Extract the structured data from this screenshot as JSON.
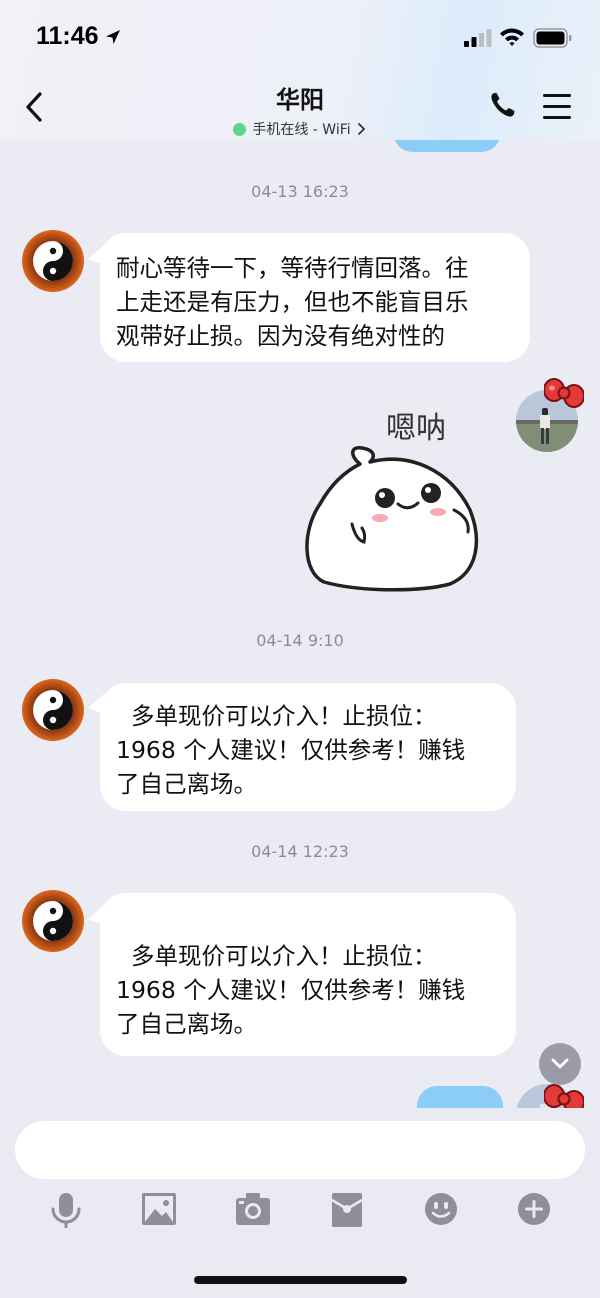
{
  "status_bar": {
    "time": "11:46",
    "icons": [
      "location-arrow-icon",
      "signal-icon",
      "wifi-icon",
      "battery-icon"
    ]
  },
  "header": {
    "back_icon": "chevron-left-icon",
    "title": "华阳",
    "subtitle": "手机在线 - WiFi",
    "online_color": "#5fd58a",
    "actions": [
      "phone-icon",
      "menu-icon"
    ]
  },
  "messages": [
    {
      "timestamp": "04-13 16:23",
      "sender": "other",
      "lines": [
        "耐心等待一下，等待行情回落。往",
        "上走还是有压力，但也不能盲目乐",
        "观带好止损。因为没有绝对性的"
      ]
    },
    {
      "sender": "self",
      "type": "sticker",
      "sticker_text": "嗯呐"
    },
    {
      "timestamp": "04-14 9:10",
      "sender": "other",
      "lines": [
        "  多单现价可以介入！止损位：",
        "1968 个人建议！仅供参考！赚钱",
        "了自己离场。"
      ]
    },
    {
      "timestamp": "04-14 12:23",
      "sender": "other",
      "lines": [
        "",
        "  多单现价可以介入！止损位：",
        "1968 个人建议！仅供参考！赚钱",
        "了自己离场。"
      ]
    }
  ],
  "input": {
    "placeholder": "",
    "value": ""
  },
  "toolbar": [
    "microphone-icon",
    "image-icon",
    "camera-icon",
    "red-envelope-icon",
    "emoji-icon",
    "plus-icon"
  ],
  "colors": {
    "background": "#ebebf3",
    "bubble_other": "#ffffff",
    "bubble_self": "#8bcdf7",
    "icon_gray": "#8e8e9c"
  }
}
